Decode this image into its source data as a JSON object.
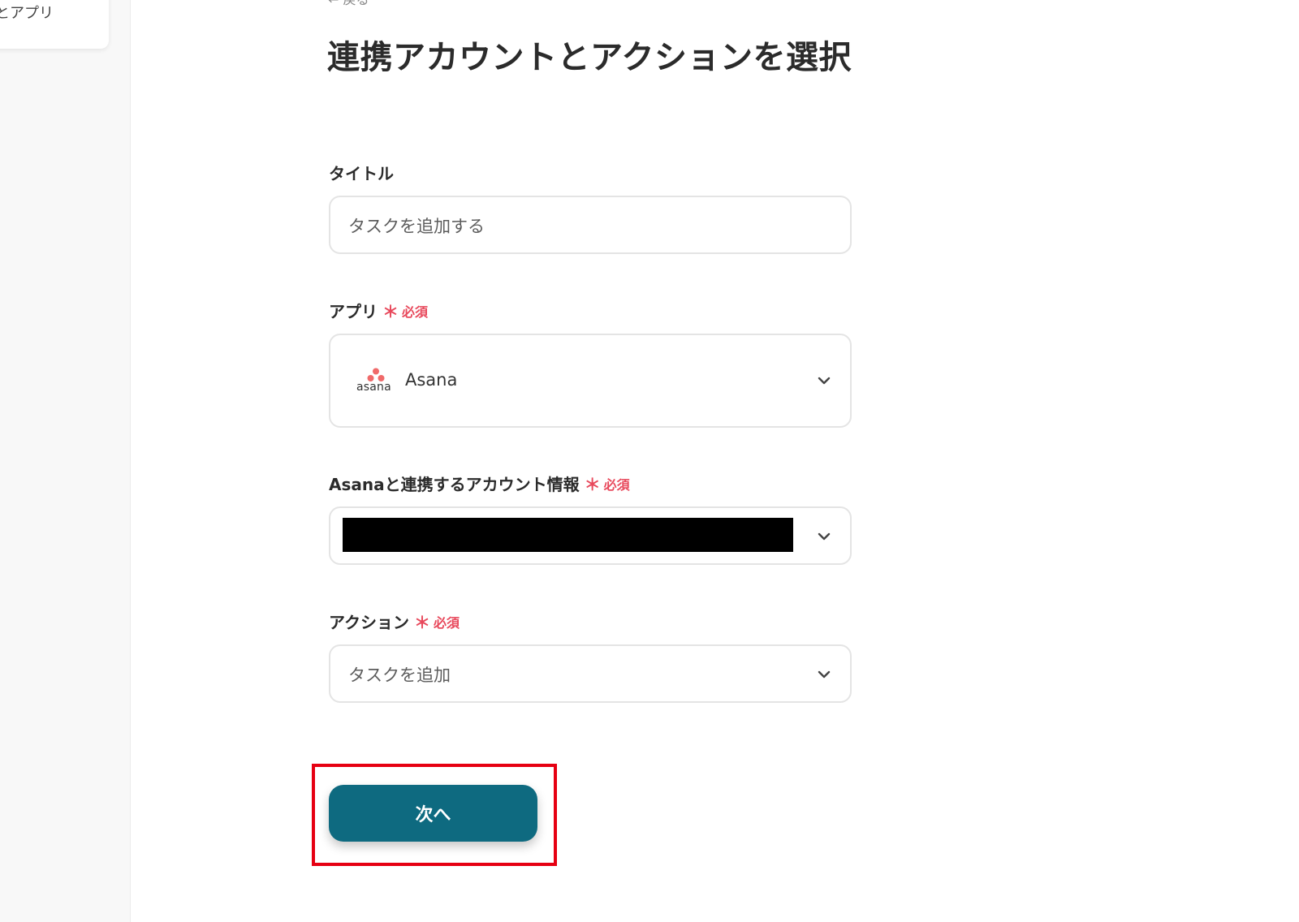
{
  "sidebar": {
    "card_label": "とアプリ"
  },
  "main": {
    "back_label": "← 戻る",
    "title": "連携アカウントとアクションを選択",
    "fields": {
      "title": {
        "label": "タイトル",
        "value": "タスクを追加する"
      },
      "app": {
        "label": "アプリ",
        "required_mark": "＊",
        "required_text": "必須",
        "value": "Asana",
        "logo_text": "asana"
      },
      "account": {
        "label": "Asanaと連携するアカウント情報",
        "required_mark": "＊",
        "required_text": "必須"
      },
      "action": {
        "label": "アクション",
        "required_mark": "＊",
        "required_text": "必須",
        "value": "タスクを追加"
      }
    },
    "next_button_label": "次へ"
  },
  "colors": {
    "accent": "#0e6a80",
    "required": "#e8495c",
    "highlight": "#e60012",
    "asana_brand": "#f06a6a"
  },
  "icons": {
    "select_chevron": "chevron-down-icon",
    "app_logo": "asana-logo-icon"
  }
}
